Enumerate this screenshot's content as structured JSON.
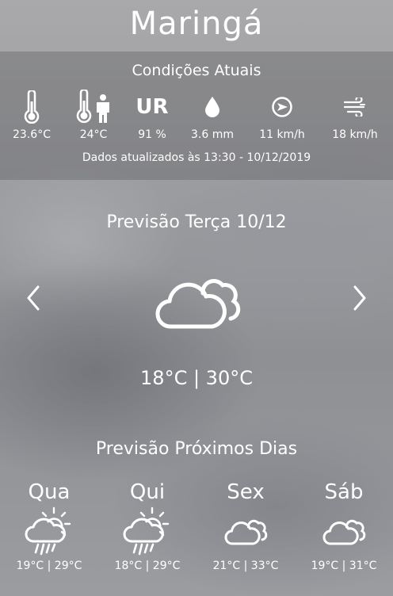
{
  "city": "Maringá",
  "current": {
    "title": "Condições Atuais",
    "metrics": [
      {
        "icon": "thermometer-icon",
        "value": "23.6°C"
      },
      {
        "icon": "feels-like-icon",
        "value": "24°C"
      },
      {
        "icon": "humidity-ur-icon",
        "label": "UR",
        "value": "91 %"
      },
      {
        "icon": "raindrop-icon",
        "value": "3.6 mm"
      },
      {
        "icon": "wind-direction-icon",
        "value": "11 km/h"
      },
      {
        "icon": "wind-gust-icon",
        "value": "18 km/h"
      }
    ],
    "updated": "Dados atualizados às 13:30 - 10/12/2019"
  },
  "forecast": {
    "title": "Previsão Terça 10/12",
    "icon": "cloudy-icon",
    "temps": "18°C | 30°C"
  },
  "next": {
    "title": "Previsão Próximos Dias",
    "days": [
      {
        "name": "Qua",
        "icon": "sun-cloud-rain-icon",
        "range": "19°C | 29°C"
      },
      {
        "name": "Qui",
        "icon": "sun-cloud-rain-icon",
        "range": "18°C | 29°C"
      },
      {
        "name": "Sex",
        "icon": "cloudy-icon",
        "range": "21°C | 33°C"
      },
      {
        "name": "Sáb",
        "icon": "cloudy-icon",
        "range": "19°C | 31°C"
      }
    ]
  }
}
